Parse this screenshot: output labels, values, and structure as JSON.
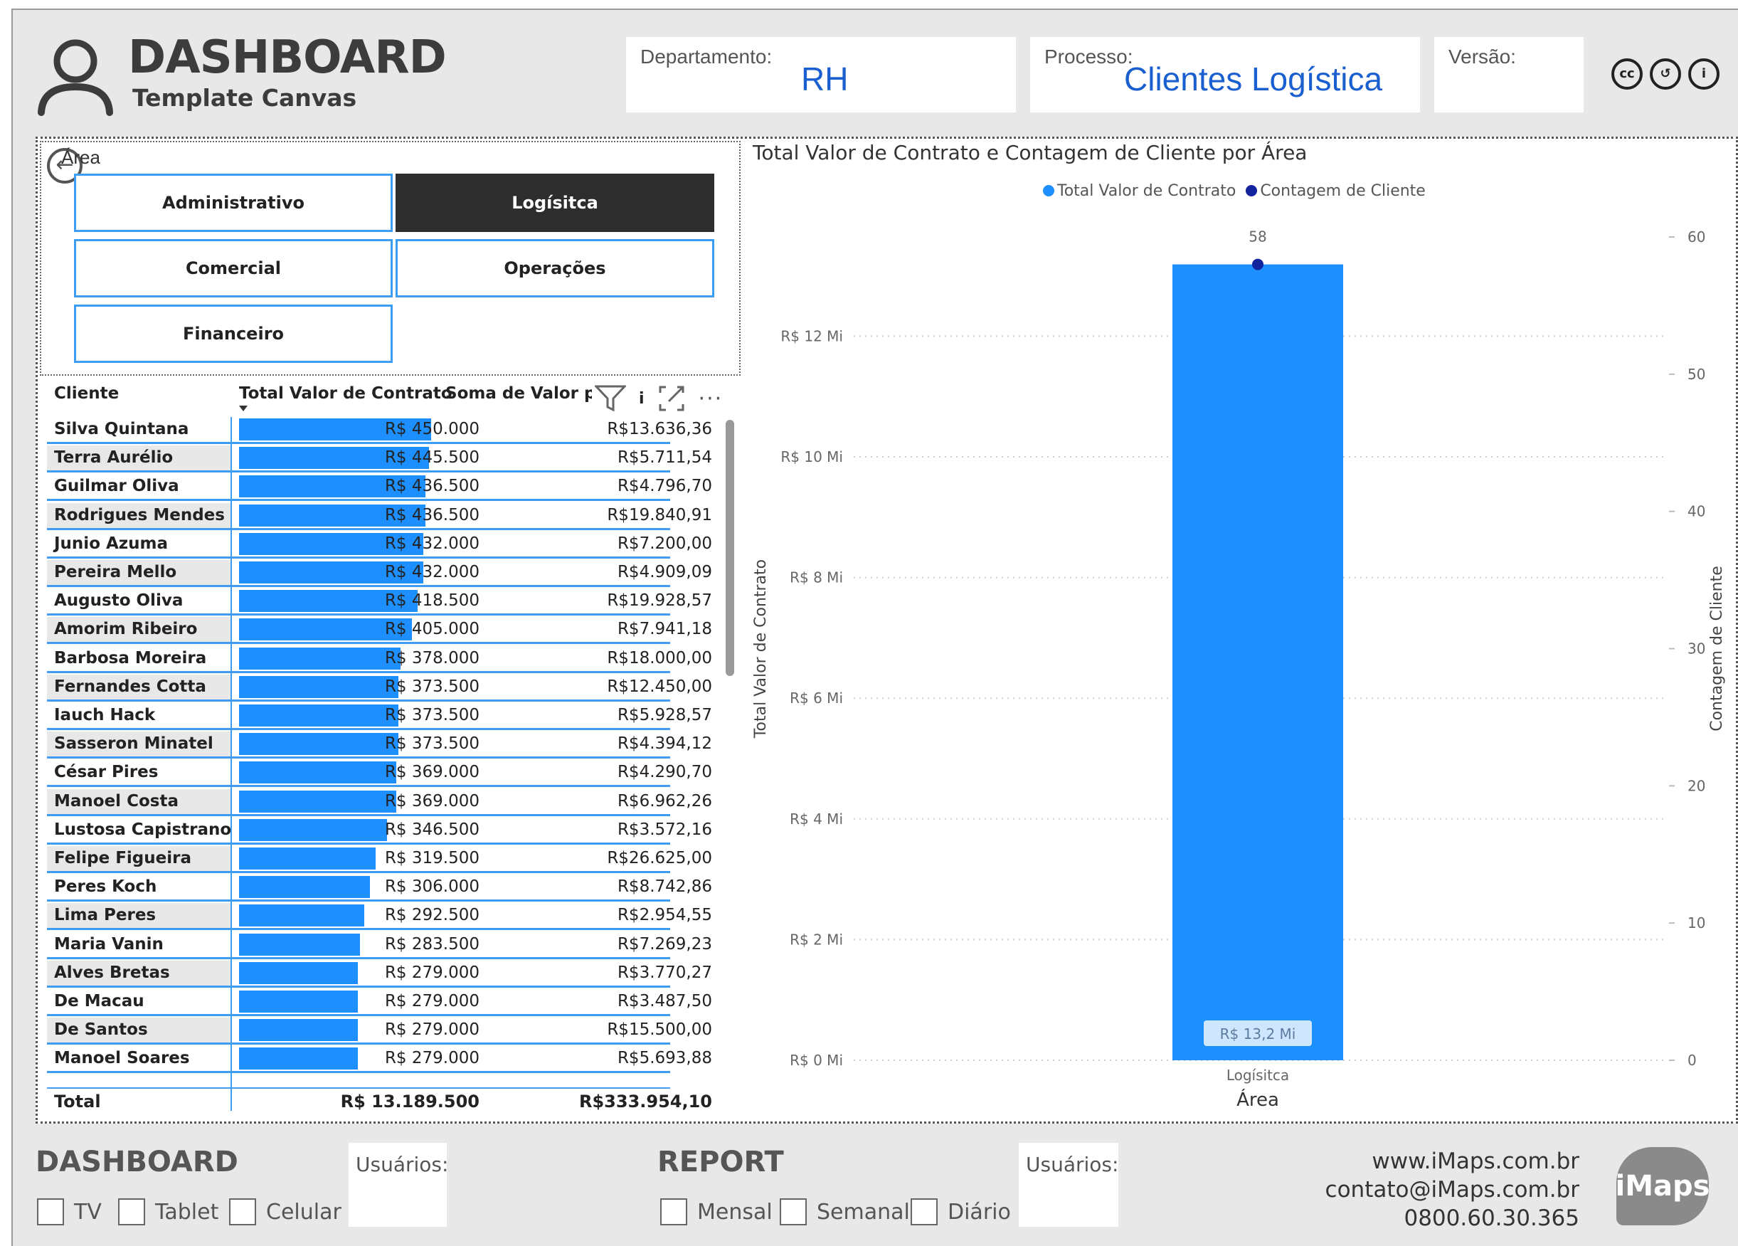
{
  "header": {
    "title": "DASHBOARD",
    "subtitle": "Template Canvas",
    "fields": [
      {
        "label": "Departamento:",
        "value": "RH"
      },
      {
        "label": "Processo:",
        "value": "Clientes Logística"
      },
      {
        "label": "Versão:",
        "value": ""
      }
    ],
    "license_icons": [
      "cc-icon",
      "by-icon",
      "info-icon"
    ]
  },
  "slicer": {
    "title": "Área",
    "options": [
      {
        "label": "Administrativo",
        "selected": false
      },
      {
        "label": "Logísitca",
        "selected": true
      },
      {
        "label": "Comercial",
        "selected": false
      },
      {
        "label": "Operações",
        "selected": false
      },
      {
        "label": "Financeiro",
        "selected": false
      }
    ]
  },
  "table": {
    "headers": [
      "Cliente",
      "Total Valor de Contrato",
      "Soma de Valor pc"
    ],
    "header_tail": "i",
    "rows": [
      {
        "cliente": "Silva Quintana",
        "contrato": "R$ 450.000",
        "valor": "R$13.636,36",
        "amount": 450000
      },
      {
        "cliente": "Terra Aurélio",
        "contrato": "R$ 445.500",
        "valor": "R$5.711,54",
        "amount": 445500
      },
      {
        "cliente": "Guilmar Oliva",
        "contrato": "R$ 436.500",
        "valor": "R$4.796,70",
        "amount": 436500
      },
      {
        "cliente": "Rodrigues Mendes",
        "contrato": "R$ 436.500",
        "valor": "R$19.840,91",
        "amount": 436500
      },
      {
        "cliente": "Junio Azuma",
        "contrato": "R$ 432.000",
        "valor": "R$7.200,00",
        "amount": 432000
      },
      {
        "cliente": "Pereira Mello",
        "contrato": "R$ 432.000",
        "valor": "R$4.909,09",
        "amount": 432000
      },
      {
        "cliente": "Augusto Oliva",
        "contrato": "R$ 418.500",
        "valor": "R$19.928,57",
        "amount": 418500
      },
      {
        "cliente": "Amorim Ribeiro",
        "contrato": "R$ 405.000",
        "valor": "R$7.941,18",
        "amount": 405000
      },
      {
        "cliente": "Barbosa Moreira",
        "contrato": "R$ 378.000",
        "valor": "R$18.000,00",
        "amount": 378000
      },
      {
        "cliente": "Fernandes Cotta",
        "contrato": "R$ 373.500",
        "valor": "R$12.450,00",
        "amount": 373500
      },
      {
        "cliente": "Iauch Hack",
        "contrato": "R$ 373.500",
        "valor": "R$5.928,57",
        "amount": 373500
      },
      {
        "cliente": "Sasseron Minatel",
        "contrato": "R$ 373.500",
        "valor": "R$4.394,12",
        "amount": 373500
      },
      {
        "cliente": "César Pires",
        "contrato": "R$ 369.000",
        "valor": "R$4.290,70",
        "amount": 369000
      },
      {
        "cliente": "Manoel Costa",
        "contrato": "R$ 369.000",
        "valor": "R$6.962,26",
        "amount": 369000
      },
      {
        "cliente": "Lustosa Capistrano",
        "contrato": "R$ 346.500",
        "valor": "R$3.572,16",
        "amount": 346500
      },
      {
        "cliente": "Felipe Figueira",
        "contrato": "R$ 319.500",
        "valor": "R$26.625,00",
        "amount": 319500
      },
      {
        "cliente": "Peres Koch",
        "contrato": "R$ 306.000",
        "valor": "R$8.742,86",
        "amount": 306000
      },
      {
        "cliente": "Lima Peres",
        "contrato": "R$ 292.500",
        "valor": "R$2.954,55",
        "amount": 292500
      },
      {
        "cliente": "Maria Vanin",
        "contrato": "R$ 283.500",
        "valor": "R$7.269,23",
        "amount": 283500
      },
      {
        "cliente": "Alves Bretas",
        "contrato": "R$ 279.000",
        "valor": "R$3.770,27",
        "amount": 279000
      },
      {
        "cliente": "De Macau",
        "contrato": "R$ 279.000",
        "valor": "R$3.487,50",
        "amount": 279000
      },
      {
        "cliente": "De Santos",
        "contrato": "R$ 279.000",
        "valor": "R$15.500,00",
        "amount": 279000
      },
      {
        "cliente": "Manoel Soares",
        "contrato": "R$ 279.000",
        "valor": "R$5.693,88",
        "amount": 279000
      }
    ],
    "total": {
      "label": "Total",
      "contrato": "R$ 13.189.500",
      "valor": "R$333.954,10"
    }
  },
  "chart_data": {
    "type": "bar",
    "title": "Total Valor de Contrato e Contagem de Cliente por Área",
    "legend": [
      "Total Valor de Contrato",
      "Contagem de Cliente"
    ],
    "legend_position": "top-center",
    "categories": [
      "Logísitca"
    ],
    "series": [
      {
        "name": "Total Valor de Contrato",
        "type": "bar",
        "values": [
          13189500
        ],
        "axis": "left",
        "color": "#1e8fff",
        "data_label": "R$ 13,2 Mi"
      },
      {
        "name": "Contagem de Cliente",
        "type": "line",
        "values": [
          58
        ],
        "axis": "right",
        "color": "#12239e",
        "data_label": "58"
      }
    ],
    "xlabel": "Área",
    "ylabel": "Total Valor de Contrato",
    "y2label": "Contagem de Cliente",
    "ylim": [
      0,
      13189500
    ],
    "y_ticks": [
      "R$ 0 Mi",
      "R$ 2 Mi",
      "R$ 4 Mi",
      "R$ 6 Mi",
      "R$ 8 Mi",
      "R$ 10 Mi",
      "R$ 12 Mi"
    ],
    "y_tick_values": [
      0,
      2000000,
      4000000,
      6000000,
      8000000,
      10000000,
      12000000
    ],
    "y2_ticks": [
      "0",
      "10",
      "20",
      "30",
      "40",
      "50",
      "60"
    ],
    "y2_tick_values": [
      0,
      10,
      20,
      30,
      40,
      50,
      60
    ],
    "y2lim": [
      0,
      60
    ],
    "grid": true
  },
  "footer": {
    "dashboard": {
      "title": "DASHBOARD",
      "users_label": "Usuários:",
      "options": [
        "TV",
        "Tablet",
        "Celular"
      ]
    },
    "report": {
      "title": "REPORT",
      "users_label": "Usuários:",
      "options": [
        "Mensal",
        "Semanal",
        "Diário"
      ]
    },
    "contact": {
      "site": "www.iMaps.com.br",
      "email": "contato@iMaps.com.br",
      "phone": "0800.60.30.365"
    },
    "logo_text": "iMaps"
  }
}
